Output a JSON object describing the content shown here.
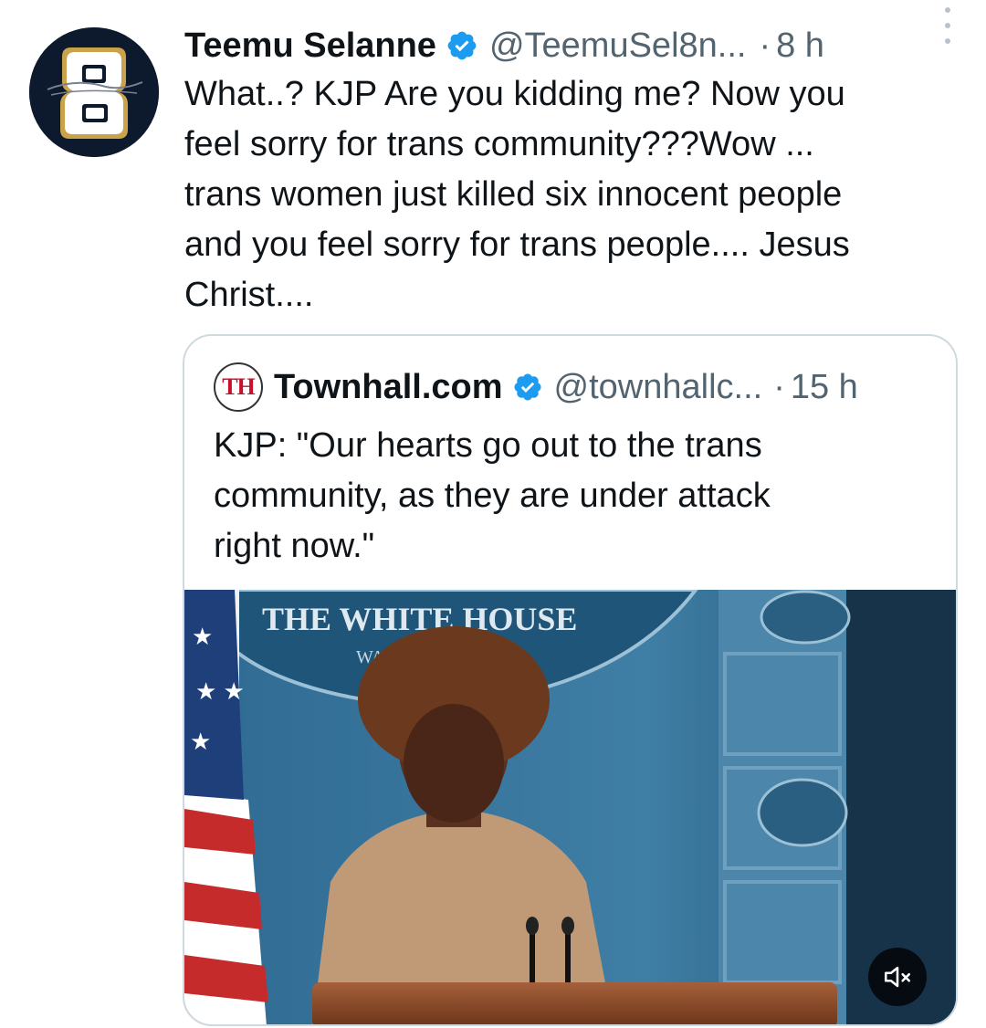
{
  "tweet": {
    "author_name": "Teemu Selanne",
    "handle": "@TeemuSel8n...",
    "separator": "·",
    "time": "8 h",
    "avatar_icon": "number-8-jersey-logo-icon",
    "text_lines": [
      "What..? KJP Are you kidding me? Now you",
      "feel sorry for trans community???Wow ...",
      "trans women just killed six innocent people",
      "and you feel sorry for trans people.... Jesus",
      "Christ...."
    ]
  },
  "quoted_tweet": {
    "avatar_text": "TH",
    "author_name": "Townhall.com",
    "handle": "@townhallc...",
    "separator": "·",
    "time": "15 h",
    "text_lines": [
      "KJP: \"Our hearts go out to the trans",
      "community, as they are under attack",
      "right now.\""
    ],
    "media": {
      "seal_text": "THE WHITE HOUSE",
      "seal_subtext": "WASHINGTON",
      "mute_icon": "speaker-muted-icon"
    }
  },
  "colors": {
    "verified_blue": "#1d9bf0",
    "secondary_text": "#536471",
    "primary_text": "#0f1419",
    "border": "#cfd9de"
  }
}
